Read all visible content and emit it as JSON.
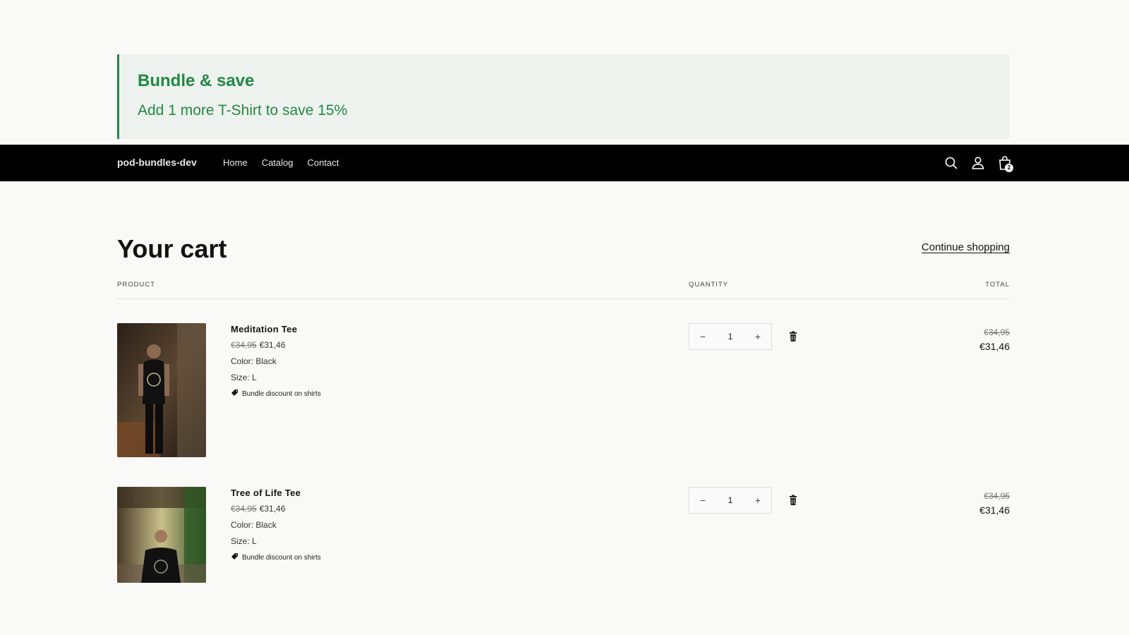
{
  "banner": {
    "title": "Bundle & save",
    "text": "Add 1 more T-Shirt to save 15%",
    "accent_color": "#1f8a45"
  },
  "header": {
    "logo": "pod-bundles-dev",
    "nav": [
      "Home",
      "Catalog",
      "Contact"
    ],
    "icons": [
      "search-icon",
      "account-icon",
      "cart-icon"
    ],
    "cart_count": "2"
  },
  "cart": {
    "title": "Your cart",
    "continue_label": "Continue shopping",
    "columns": {
      "product": "PRODUCT",
      "quantity": "QUANTITY",
      "total": "TOTAL"
    },
    "items": [
      {
        "name": "Meditation Tee",
        "original_price": "€34,95",
        "price": "€31,46",
        "color": "Color: Black",
        "size": "Size: L",
        "discount": "Bundle discount on shirts",
        "quantity": "1",
        "total_original": "€34,95",
        "total": "€31,46"
      },
      {
        "name": "Tree of Life Tee",
        "original_price": "€34,95",
        "price": "€31,46",
        "color": "Color: Black",
        "size": "Size: L",
        "discount": "Bundle discount on shirts",
        "quantity": "1",
        "total_original": "€34,95",
        "total": "€31,46"
      }
    ]
  }
}
